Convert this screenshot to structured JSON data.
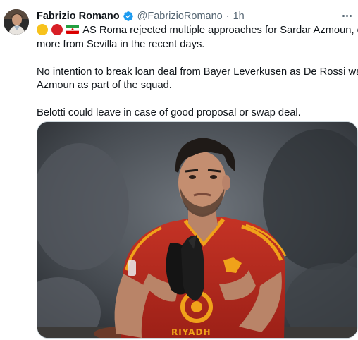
{
  "tweet": {
    "author_name": "Fabrizio Romano",
    "handle": "@FabrizioRomano",
    "separator": "·",
    "time": "1h",
    "verified_color": "#1d9bf0",
    "lines": {
      "l1": "AS Roma rejected multiple approaches for Sardar Azmoun, one",
      "l2": "more from Sevilla in the recent days.",
      "l3": "No intention to break loan deal from Bayer Leverkusen as De Rossi wants",
      "l4": "Azmoun as part of the squad.",
      "l5": "Belotti could leave in case of good proposal or swap deal."
    },
    "emojis": [
      "yellow-circle-icon",
      "red-circle-icon",
      "iran-flag-icon"
    ],
    "media": {
      "shirt_sponsor": "RIYADH",
      "jersey_color": "#b8291f",
      "trim_color": "#f0a21a"
    }
  }
}
